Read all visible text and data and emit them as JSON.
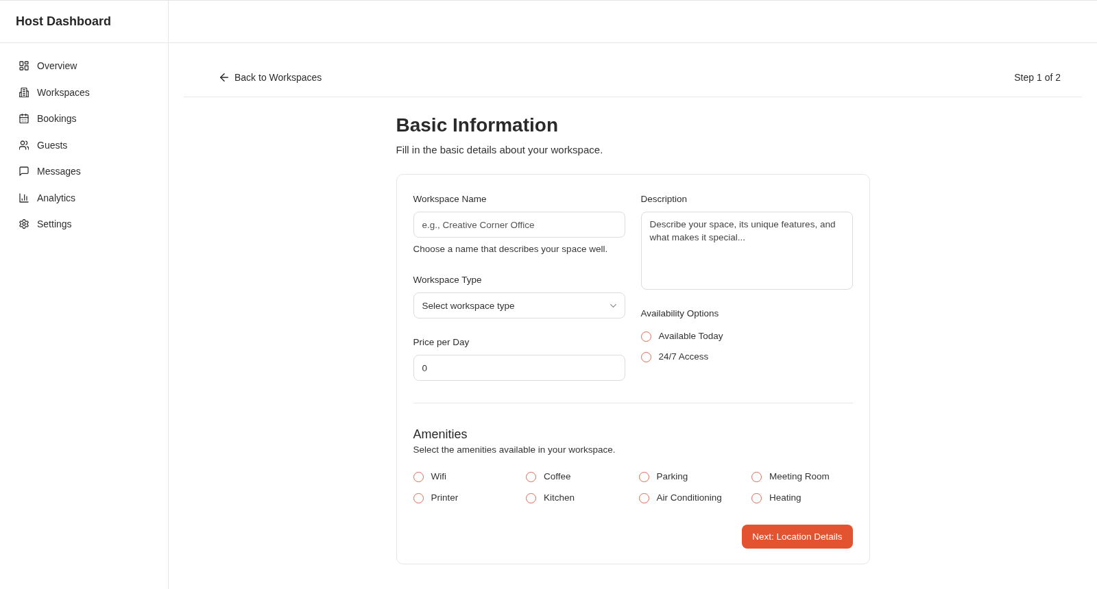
{
  "sidebar": {
    "title": "Host Dashboard",
    "items": [
      {
        "label": "Overview",
        "selected": false
      },
      {
        "label": "Workspaces",
        "selected": false
      },
      {
        "label": "Bookings",
        "selected": false
      },
      {
        "label": "Guests",
        "selected": false
      },
      {
        "label": "Messages",
        "selected": false
      },
      {
        "label": "Analytics",
        "selected": false
      },
      {
        "label": "Settings",
        "selected": false
      }
    ]
  },
  "top_bar": {
    "back_link": "Back to Workspaces",
    "step": "Step 1 of 2"
  },
  "form": {
    "title": "Basic Information",
    "subtitle": "Fill in the basic details about your workspace.",
    "workspace_name": {
      "label": "Workspace Name",
      "placeholder": "e.g., Creative Corner Office",
      "hint": "Choose a name that describes your space well."
    },
    "workspace_type": {
      "label": "Workspace Type",
      "placeholder": "Select workspace type"
    },
    "price_per_day": {
      "label": "Price per Day",
      "value": "0"
    },
    "description": {
      "label": "Description",
      "placeholder": "Describe your space, its unique features, and what makes it special..."
    },
    "availability": {
      "label": "Availability Options",
      "options": [
        {
          "label": "Available Today",
          "checked": false
        },
        {
          "label": "24/7 Access",
          "checked": false
        }
      ]
    },
    "amenities": {
      "title": "Amenities",
      "subtitle": "Select the amenities available in your workspace.",
      "options": [
        {
          "label": "Wifi",
          "checked": false
        },
        {
          "label": "Coffee",
          "checked": false
        },
        {
          "label": "Parking",
          "checked": false
        },
        {
          "label": "Meeting Room",
          "checked": false
        },
        {
          "label": "Printer",
          "checked": false
        },
        {
          "label": "Kitchen",
          "checked": false
        },
        {
          "label": "Air Conditioning",
          "checked": false
        },
        {
          "label": "Heating",
          "checked": false
        }
      ]
    },
    "next_button": "Next: Location Details"
  }
}
